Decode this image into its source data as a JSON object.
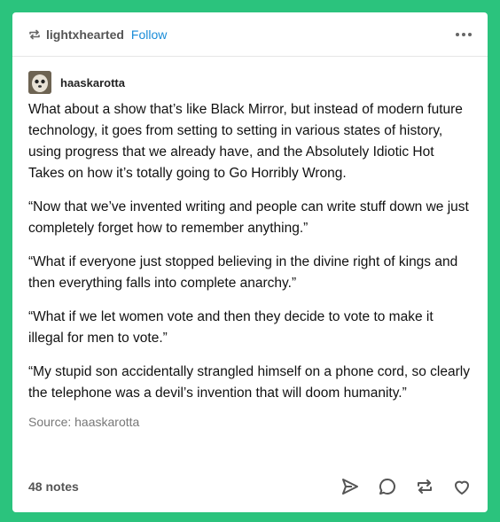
{
  "header": {
    "reblogger": "lightxhearted",
    "follow_label": "Follow"
  },
  "post": {
    "author": "haaskarotta",
    "paragraphs": [
      "What about a show that’s like Black Mirror, but instead of modern future technology, it goes from setting to setting in various states of history, using progress that we already have, and the Absolutely Idiotic Hot Takes on how it’s totally going to Go Horribly Wrong.",
      " “Now that we’ve invented writing and people can write stuff down we just completely forget how to remember anything.”",
      " “What if everyone just stopped believing in the divine right of kings and then everything falls into complete anarchy.”",
      " “What if we let women vote and then they decide to vote to make it illegal for men to vote.”",
      " “My stupid son accidentally strangled himself on a phone cord, so clearly the telephone was a devil’s invention that will doom humanity.”"
    ],
    "source": "Source: haaskarotta"
  },
  "footer": {
    "notes": "48 notes",
    "icons": [
      "send-icon",
      "reply-icon",
      "reblog-icon",
      "like-icon"
    ]
  },
  "colors": {
    "background": "#2bc37d",
    "follow": "#1a8cd8"
  }
}
